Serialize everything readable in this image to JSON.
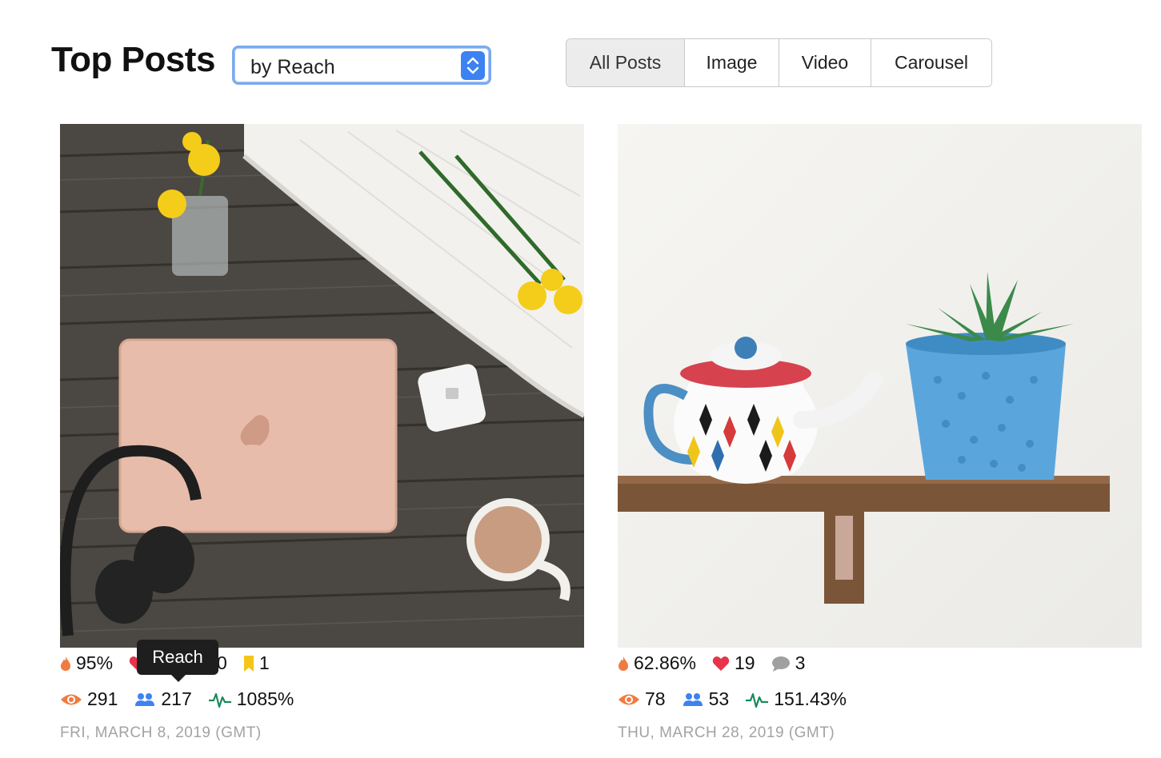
{
  "header": {
    "title": "Top Posts",
    "sort_select": {
      "value": "by Reach"
    }
  },
  "filter_tabs": [
    {
      "label": "All Posts",
      "active": true
    },
    {
      "label": "Image",
      "active": false
    },
    {
      "label": "Video",
      "active": false
    },
    {
      "label": "Carousel",
      "active": false
    }
  ],
  "colors": {
    "select_border": "#7aaaf0",
    "select_arrow_bg": "#3d82f2",
    "flame": "#f07b3f",
    "heart": "#e8334a",
    "comment": "#a0a0a0",
    "bookmark": "#f5c518",
    "eye": "#f07b3f",
    "people": "#3d82f2",
    "pulse": "#1a8a5a",
    "date": "#a3a3a3"
  },
  "posts": [
    {
      "photo_desc_icon": "laptop-flatlay-photo",
      "engagement": "95%",
      "likes": "",
      "comments": "0",
      "saves": "1",
      "impressions": "291",
      "reach": "217",
      "growth": "1085%",
      "date": "FRI, MARCH 8, 2019 (GMT)"
    },
    {
      "photo_desc_icon": "teapot-shelf-photo",
      "engagement": "62.86%",
      "likes": "19",
      "comments": "3",
      "impressions": "78",
      "reach": "53",
      "growth": "151.43%",
      "date": "THU, MARCH 28, 2019 (GMT)"
    }
  ],
  "tooltip": {
    "label": "Reach"
  }
}
